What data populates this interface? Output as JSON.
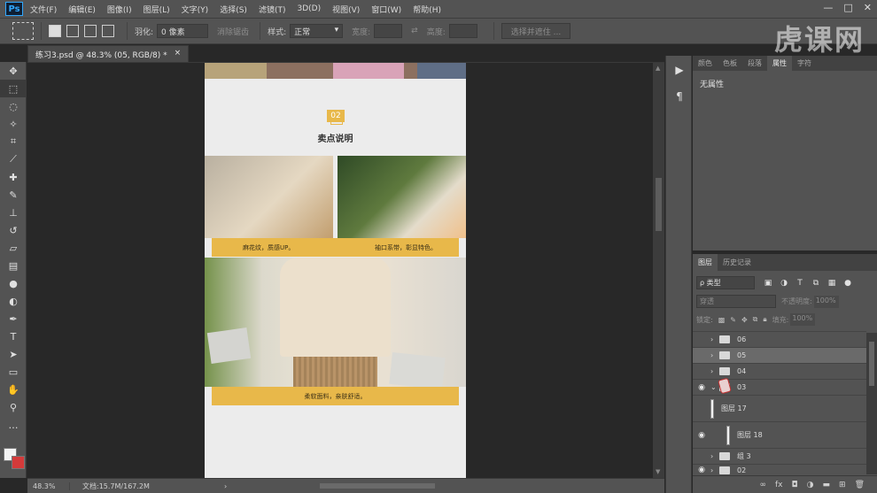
{
  "app": {
    "logo": "Ps",
    "menu": [
      "文件(F)",
      "编辑(E)",
      "图像(I)",
      "图层(L)",
      "文字(Y)",
      "选择(S)",
      "滤镜(T)",
      "3D(D)",
      "视图(V)",
      "窗口(W)",
      "帮助(H)"
    ],
    "window_controls": [
      "—",
      "□",
      "✕"
    ]
  },
  "options": {
    "feather_label": "羽化:",
    "feather_value": "0 像素",
    "antialias_label": "消除锯齿",
    "style_label": "样式:",
    "style_value": "正常",
    "width_label": "宽度:",
    "height_label": "高度:",
    "select_mask_button": "选择并遮住 ..."
  },
  "watermark": "虎课网",
  "document": {
    "tab_title": "练习3.psd @ 48.3% (05, RGB/8) *",
    "close": "×"
  },
  "artwork": {
    "badge_number": "02",
    "section_title": "卖点说明",
    "caption_left": "麻花纹，质感UP。",
    "caption_right": "袖口系带，彰显特色。",
    "caption_bottom": "柔软面料，亲肤舒适。"
  },
  "status": {
    "zoom": "48.3%",
    "doc_info": "文档:15.7M/167.2M"
  },
  "properties": {
    "tabs": [
      "颜色",
      "色板",
      "段落",
      "属性",
      "字符"
    ],
    "active_tab": "属性",
    "body_text": "无属性"
  },
  "layers": {
    "tabs": [
      "图层",
      "历史记录"
    ],
    "active_tab": "图层",
    "kind_select": "ρ 类型",
    "blend_mode": "穿透",
    "opacity_label": "不透明度:",
    "opacity_value": "100%",
    "lock_label": "锁定:",
    "fill_label": "填充:",
    "fill_value": "100%",
    "rows": [
      {
        "name": "06",
        "type": "group",
        "visible": false,
        "expanded": false
      },
      {
        "name": "05",
        "type": "group",
        "visible": false,
        "expanded": false,
        "selected": true
      },
      {
        "name": "04",
        "type": "group",
        "visible": false,
        "expanded": false
      },
      {
        "name": "03",
        "type": "group",
        "visible": true,
        "expanded": true
      },
      {
        "name": "图层 17",
        "type": "layer",
        "visible": false
      },
      {
        "name": "图层 18",
        "type": "layer",
        "visible": true
      },
      {
        "name": "组 3",
        "type": "group",
        "visible": false,
        "expanded": false
      },
      {
        "name": "02",
        "type": "group",
        "visible": true,
        "expanded": false
      }
    ],
    "footer_icons": [
      "link-icon",
      "fx-icon",
      "mask-icon",
      "adjustment-icon",
      "folder-icon",
      "new-layer-icon",
      "trash-icon"
    ]
  }
}
